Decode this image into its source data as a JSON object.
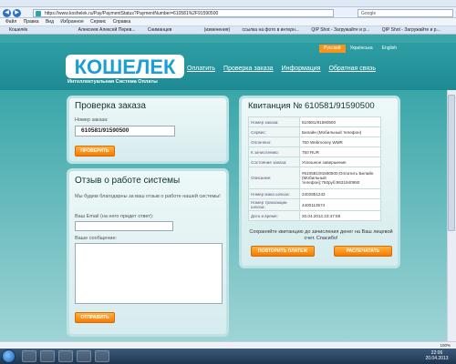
{
  "browser": {
    "url": "https://www.koshelek.ru/Pay/PaymentStatus?PaymentNumber=610581%2F91590500",
    "search_placeholder": "Google",
    "menu": [
      "Файл",
      "Правка",
      "Вид",
      "Избранное",
      "Сервис",
      "Справка"
    ],
    "tabs": [
      "Кошелёк",
      "Алексеев Алексей Перев...",
      "Сниманцев",
      "(изменения)",
      "ссылка на фото в интерн...",
      "QIP Shot - Загружайте и р...",
      "QIP Shot - Загружайте и р..."
    ],
    "zoom": "100%"
  },
  "header": {
    "lang": [
      "Русский",
      "Українська",
      "English"
    ],
    "logo_text": "КОШЕЛЕК",
    "tagline": "Интеллектуальная Система Оплаты",
    "nav": [
      "Оплатить",
      "Проверка заказа",
      "Информация",
      "Обратная связь"
    ]
  },
  "check": {
    "title": "Проверка заказа",
    "order_label": "Номер заказа:",
    "order_value": "610581/91590500",
    "button": "ПРОВЕРИТЬ"
  },
  "feedback": {
    "title": "Отзыв о работе системы",
    "intro": "Мы будем благодарны за ваш отзыв о работе нашей системы!",
    "email_label": "Ваш Email (на него придет ответ):",
    "message_label": "Ваше сообщение:",
    "button": "ОТПРАВИТЬ"
  },
  "receipt": {
    "title": "Квитанция № 610581/91590500",
    "rows": [
      {
        "k": "Номер заказа:",
        "v": "610581/91590500"
      },
      {
        "k": "Сервис:",
        "v": "Билайн (Мобильный телефон)"
      },
      {
        "k": "Оплачено:",
        "v": "750 Webmoney WMR"
      },
      {
        "k": "К зачислению:",
        "v": "750 RUR"
      },
      {
        "k": "Состояние заказа:",
        "v": "Успешное завершение"
      },
      {
        "k": "Описание:",
        "v": "#610581/91590500;Оплатить Билайн (Мобильный телефон);750руб;9631940950"
      },
      {
        "k": "Номер мака шлюза:",
        "v": "2402851242"
      },
      {
        "k": "Номер транзакции шлюза:",
        "v": "4400113574"
      },
      {
        "k": "Дата и время:",
        "v": "20.04.2013 23:47:58"
      }
    ],
    "note": "Сохраняйте квитанцию до зачисления денег на Ваш лицевой счет. Спасибо!",
    "repeat_button": "ПОВТОРИТЬ ПЛАТЕЖ",
    "print_button": "РАСПЕЧАТАТЬ"
  },
  "taskbar": {
    "time": "22:06",
    "date": "20.04.2013"
  },
  "colors": {
    "accent": "#f7941d",
    "teal": "#2f9ea4"
  }
}
